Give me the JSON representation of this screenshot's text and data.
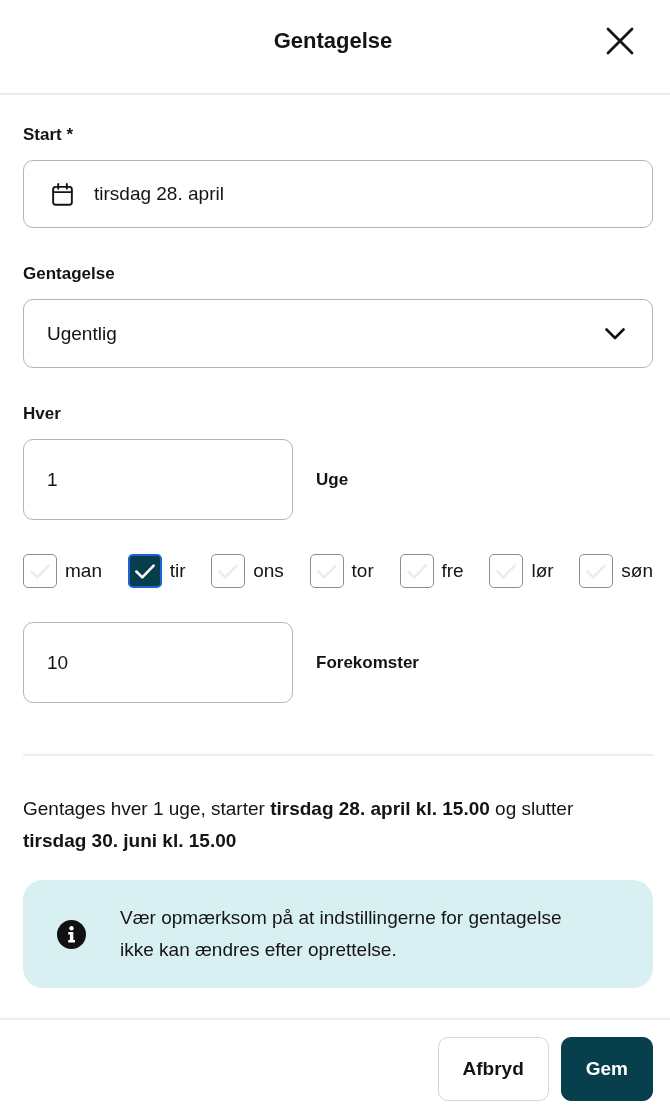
{
  "header": {
    "title": "Gentagelse"
  },
  "start": {
    "label": "Start *",
    "value": "tirsdag 28. april"
  },
  "repeat": {
    "label": "Gentagelse",
    "value": "Ugentlig"
  },
  "interval": {
    "label": "Hver",
    "value": "1",
    "unit": "Uge"
  },
  "days": [
    {
      "label": "man",
      "checked": false,
      "focused": false
    },
    {
      "label": "tir",
      "checked": true,
      "focused": true
    },
    {
      "label": "ons",
      "checked": false,
      "focused": false
    },
    {
      "label": "tor",
      "checked": false,
      "focused": false
    },
    {
      "label": "fre",
      "checked": false,
      "focused": false
    },
    {
      "label": "lør",
      "checked": false,
      "focused": false
    },
    {
      "label": "søn",
      "checked": false,
      "focused": false
    }
  ],
  "occurrences": {
    "value": "10",
    "unit": "Forekomster"
  },
  "summary": "Gentages hver 1 uge, starter **tirsdag 28. april kl. 15.00** og slutter **tirsdag 30. juni kl. 15.00**",
  "notice": {
    "text": "Vær opmærksom på at indstillingerne for gentagelse ikke kan ændres efter oprettelse."
  },
  "buttons": [
    {
      "label": "Afbryd",
      "kind": "secondary"
    },
    {
      "label": "Gem",
      "kind": "primary"
    }
  ]
}
